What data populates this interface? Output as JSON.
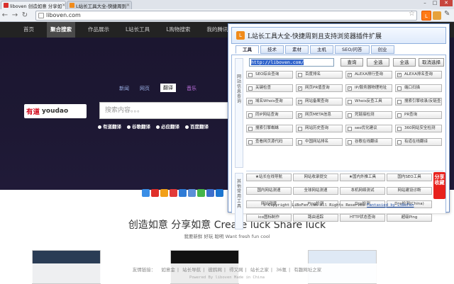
{
  "browser": {
    "tabs": [
      {
        "label": "liboven 创造如意 分享如",
        "icon_color": "#d9302c"
      },
      {
        "label": "L站长工具大全-快捷周到",
        "icon_color": "#f08b1b"
      }
    ],
    "url": "liboven.com",
    "ext_icon": "L"
  },
  "site": {
    "nav": [
      "首页",
      "聚合搜索",
      "作品展示",
      "L站长工具",
      "L购物搜索",
      "我的腾讯微博"
    ],
    "active_nav": 1,
    "youdao": {
      "tabs": [
        "新闻",
        "网页",
        "翻译",
        "音乐"
      ],
      "selected_tab": 2,
      "logo_red": "有道",
      "logo_text": "youdao",
      "placeholder": "搜索内容。。。",
      "options": [
        "有道翻译",
        "谷歌翻译",
        "必应翻译",
        "百度翻译"
      ]
    },
    "slogan": "创造如意 分享如意 Create luck Share luck",
    "slogan_sub": "我要新鲜 好玩 聪明 Want fresh fun cool",
    "footer_links": [
      "友情链接：",
      "如意金",
      "站长导航",
      "彼鸥网",
      "得又网",
      "站长之家",
      "36氪",
      "有趣网址之家"
    ],
    "footer_power": "Powered By liboven Made in China"
  },
  "popup": {
    "title": "L站长工具大全-快捷周到且支持浏览器插件扩展",
    "tabs": [
      "工具",
      "技术",
      "素材",
      "主机",
      "SEO/问答",
      "创业"
    ],
    "selected_tab": 0,
    "url_value": "http://liboven.com/",
    "buttons": {
      "query": "查询",
      "all_check": "全选",
      "select_all": "全选",
      "cancel": "取消选择"
    },
    "label_site_info": "网站信息查询",
    "label_common": "其他常用工具",
    "site_tools": [
      [
        "SEO综合查询",
        false
      ],
      [
        "百度排名",
        false
      ],
      [
        "ALEXA排行查询",
        true
      ],
      [
        "ALEXA排名查询",
        true
      ],
      [
        "关键检查",
        false
      ],
      [
        "网页PR值查询",
        true
      ],
      [
        "IP/服务器物理地址",
        true
      ],
      [
        "端口扫描",
        false
      ],
      [
        "域名Whois查询",
        true
      ],
      [
        "网站备案查询",
        true
      ],
      [
        "Whois反查工具",
        false
      ],
      [
        "搜索引擎收录/反链查询",
        false
      ],
      [
        "同IP网站查询",
        false
      ],
      [
        "网页META信息",
        true
      ],
      [
        "死链接检测",
        false
      ],
      [
        "PR查询",
        false
      ],
      [
        "搜索引擎蜘蛛",
        false
      ],
      [
        "网站历史查询",
        false
      ],
      [
        "seo优化建议",
        false
      ],
      [
        "360网站安全检测",
        false
      ],
      [
        "查看网页源代码",
        false
      ],
      [
        "中国网站排名",
        false
      ],
      [
        "谷歌在线翻译",
        false
      ],
      [
        "有道在线翻译",
        false
      ]
    ],
    "common_tools": [
      "★站长在线导航",
      "网站收录提交",
      "★国内外推工具",
      "国内SEO工具",
      "国内网站测速",
      "全球网站测速",
      "本机网络测试",
      "网站建设诊断",
      "网站测速",
      "Ping检测",
      "Dns检测",
      "Dns检测(China)",
      "ico图标制作",
      "路由追踪",
      "HTTP状态查询",
      "超级Ping"
    ],
    "share_tag": "分享收藏",
    "copyright": "© Copyright LiBoFen.com All Rights Reserved",
    "copyright_link": "Fantasied by LiBoFen"
  }
}
